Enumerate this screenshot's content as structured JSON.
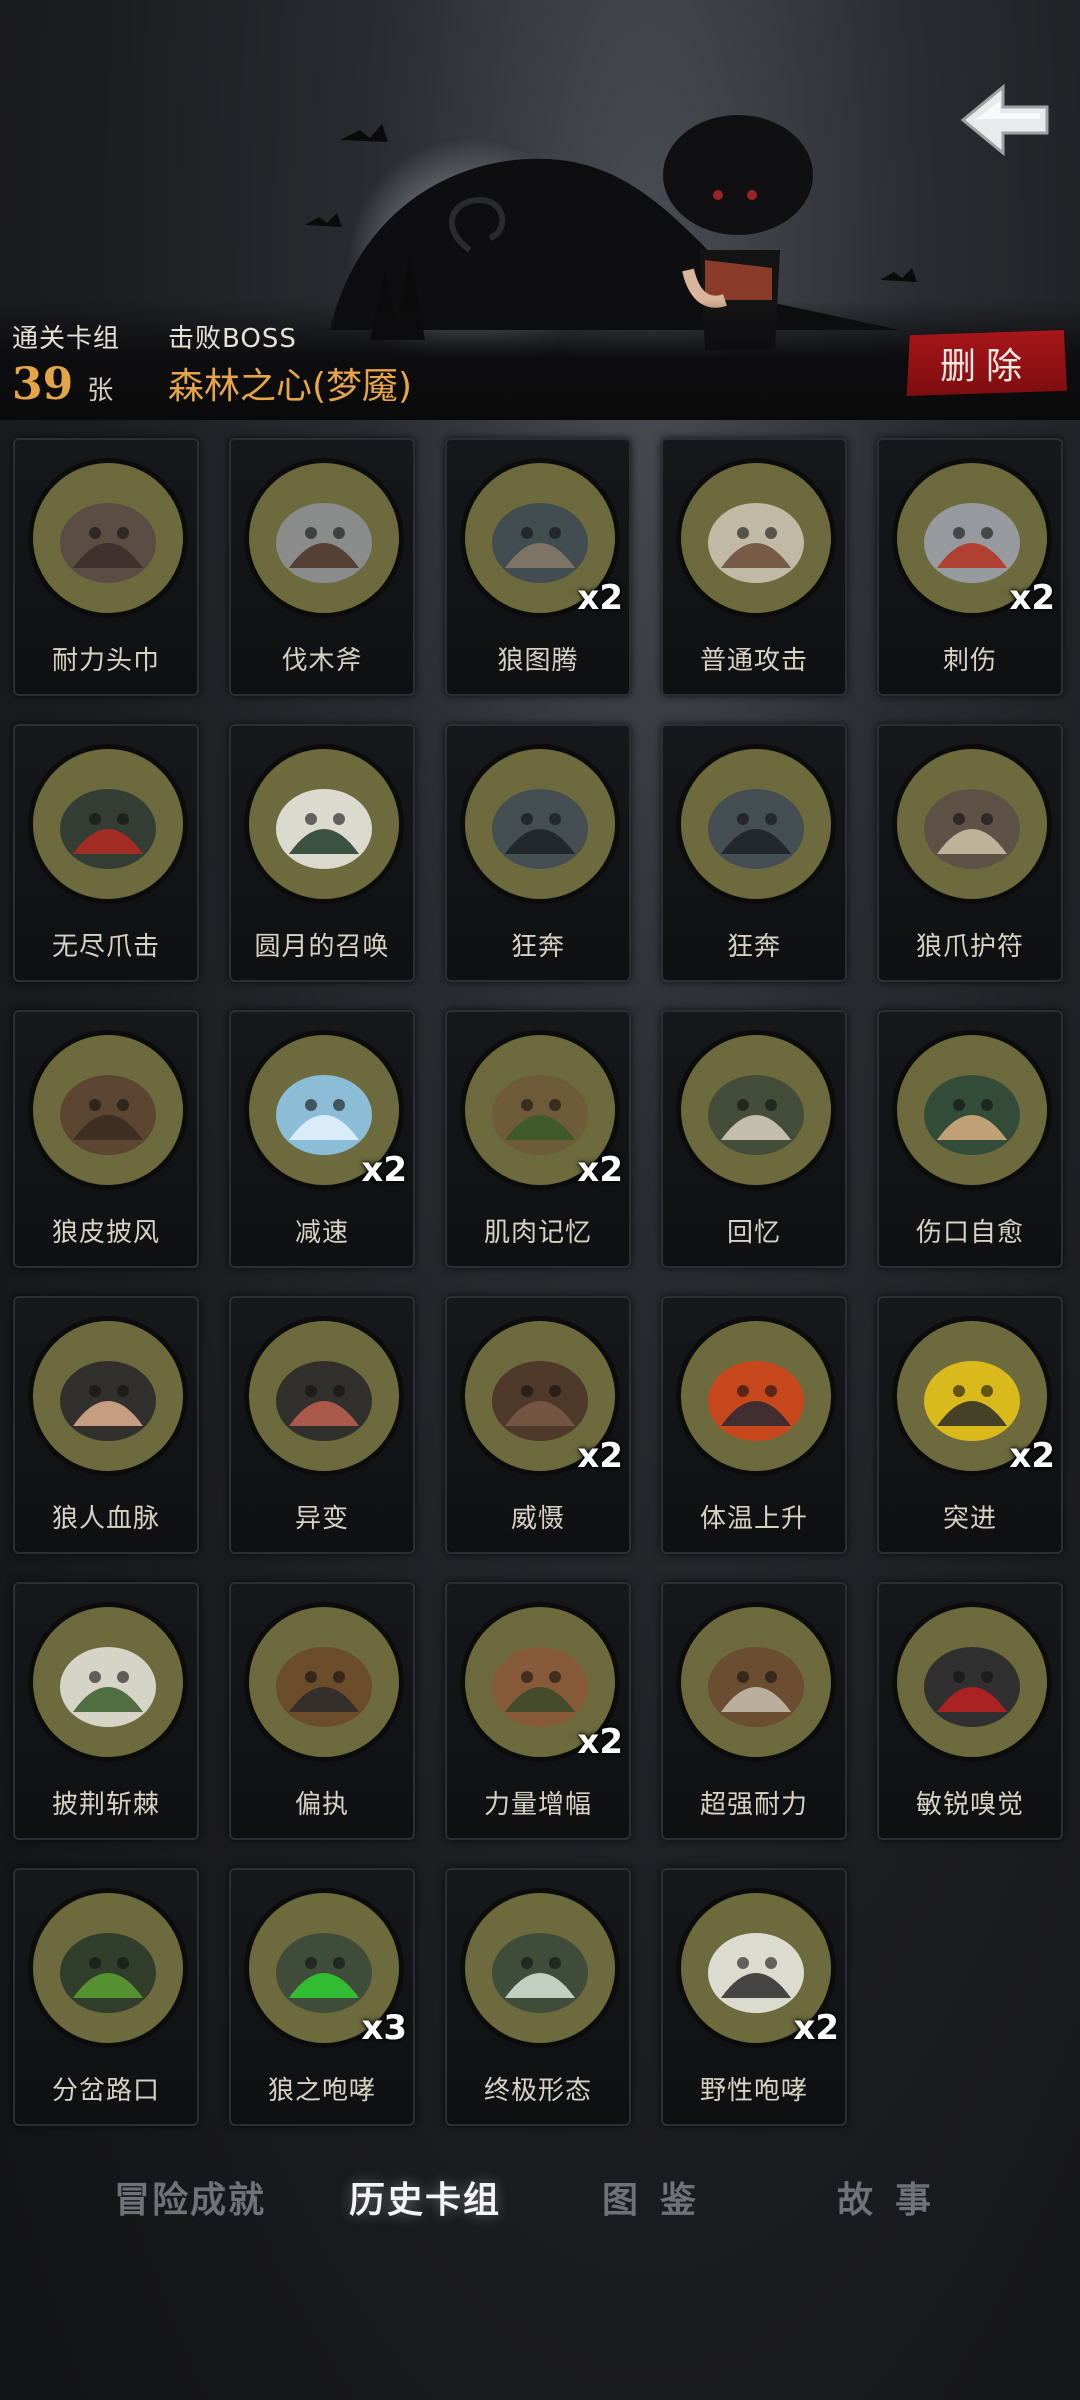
{
  "header": {
    "back_icon": "back-arrow-icon",
    "deck_label": "通关卡组",
    "deck_count": "39",
    "deck_unit": "张",
    "boss_label": "击败BOSS",
    "boss_name": "森林之心(梦魇)",
    "delete_label": "删除"
  },
  "cards": [
    {
      "name": "耐力头巾",
      "count": "",
      "icon": "bandana-icon"
    },
    {
      "name": "伐木斧",
      "count": "",
      "icon": "axe-icon"
    },
    {
      "name": "狼图腾",
      "count": "x2",
      "icon": "wolf-totem-icon"
    },
    {
      "name": "普通攻击",
      "count": "",
      "icon": "axe-swing-icon"
    },
    {
      "name": "刺伤",
      "count": "x2",
      "icon": "dagger-icon"
    },
    {
      "name": "无尽爪击",
      "count": "",
      "icon": "claw-strike-icon"
    },
    {
      "name": "圆月的召唤",
      "count": "",
      "icon": "full-moon-icon"
    },
    {
      "name": "狂奔",
      "count": "",
      "icon": "running-wolf-icon"
    },
    {
      "name": "狂奔",
      "count": "",
      "icon": "running-wolf-icon"
    },
    {
      "name": "狼爪护符",
      "count": "",
      "icon": "claw-amulet-icon"
    },
    {
      "name": "狼皮披风",
      "count": "",
      "icon": "wolf-cloak-icon"
    },
    {
      "name": "减速",
      "count": "x2",
      "icon": "clock-icon"
    },
    {
      "name": "肌肉记忆",
      "count": "x2",
      "icon": "boy-axe-icon"
    },
    {
      "name": "回忆",
      "count": "",
      "icon": "old-man-icon"
    },
    {
      "name": "伤口自愈",
      "count": "",
      "icon": "healing-hand-icon"
    },
    {
      "name": "狼人血脉",
      "count": "",
      "icon": "transform-hand-icon"
    },
    {
      "name": "异变",
      "count": "",
      "icon": "mutation-icon"
    },
    {
      "name": "威慑",
      "count": "x2",
      "icon": "bear-icon"
    },
    {
      "name": "体温上升",
      "count": "",
      "icon": "fire-wolf-icon"
    },
    {
      "name": "突进",
      "count": "x2",
      "icon": "dash-wolf-icon"
    },
    {
      "name": "披荆斩棘",
      "count": "",
      "icon": "thorn-slash-icon"
    },
    {
      "name": "偏执",
      "count": "",
      "icon": "wolf-bear-icon"
    },
    {
      "name": "力量增幅",
      "count": "x2",
      "icon": "log-lift-icon"
    },
    {
      "name": "超强耐力",
      "count": "",
      "icon": "chopping-wood-icon"
    },
    {
      "name": "敏锐嗅觉",
      "count": "",
      "icon": "wolf-eyes-icon"
    },
    {
      "name": "分岔路口",
      "count": "",
      "icon": "forest-path-icon"
    },
    {
      "name": "狼之咆哮",
      "count": "x3",
      "icon": "howl-icon"
    },
    {
      "name": "终极形态",
      "count": "",
      "icon": "ultimate-wolf-icon"
    },
    {
      "name": "野性咆哮",
      "count": "x2",
      "icon": "moon-howl-icon"
    }
  ],
  "tabs": [
    {
      "label": "冒险成就",
      "active": false
    },
    {
      "label": "历史卡组",
      "active": true
    },
    {
      "label": "图鉴",
      "active": false
    },
    {
      "label": "故事",
      "active": false
    }
  ],
  "colors": {
    "accent_orange": "#e4a548",
    "delete_red": "#a8161a",
    "card_art_bg": "#6d6a3e"
  }
}
